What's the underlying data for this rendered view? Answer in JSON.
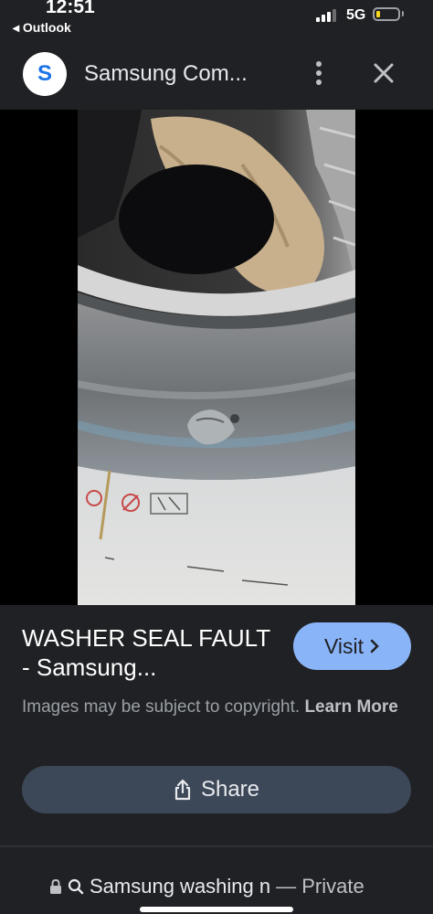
{
  "status": {
    "time": "12:51",
    "back_app": "◂ Outlook",
    "network": "5G"
  },
  "header": {
    "favicon_letter": "S",
    "site_name": "Samsung Com...",
    "menu_icon": "more-vert-icon",
    "close_icon": "close-icon"
  },
  "image": {
    "lens_icon": "google-lens-icon"
  },
  "result": {
    "title": "WASHER SEAL FAULT - Samsung...",
    "visit_label": "Visit",
    "copyright_text": "Images may be subject to copyright.",
    "learn_more": "Learn More",
    "share_label": "Share"
  },
  "address_bar": {
    "query": "Samsung washing n",
    "private": "— Private"
  },
  "colors": {
    "background": "#202124",
    "visit_button": "#8ab4f8",
    "share_button": "#3c4758",
    "favicon": "#1a73e8"
  }
}
